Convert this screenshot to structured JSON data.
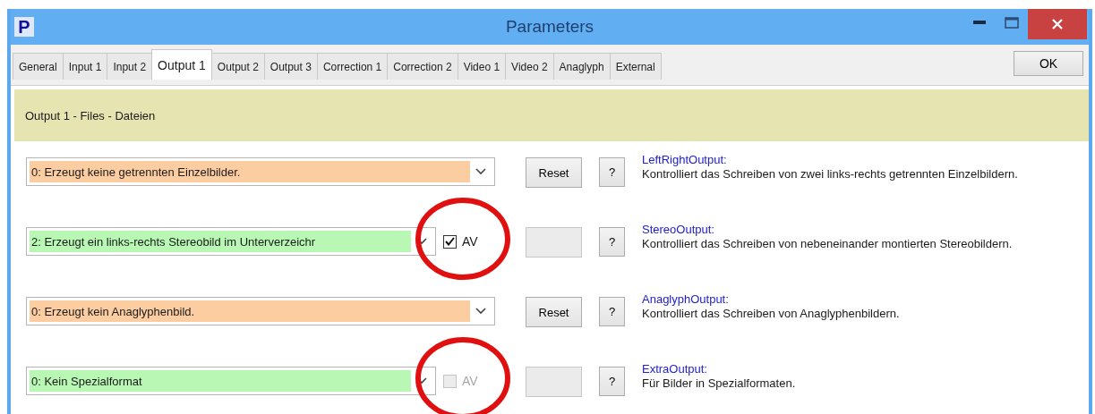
{
  "window": {
    "title": "Parameters",
    "icon_letter": "P"
  },
  "tabs": [
    {
      "label": "General",
      "selected": false
    },
    {
      "label": "Input 1",
      "selected": false
    },
    {
      "label": "Input 2",
      "selected": false
    },
    {
      "label": "Output 1",
      "selected": true
    },
    {
      "label": "Output 2",
      "selected": false
    },
    {
      "label": "Output 3",
      "selected": false
    },
    {
      "label": "Correction 1",
      "selected": false
    },
    {
      "label": "Correction 2",
      "selected": false
    },
    {
      "label": "Video 1",
      "selected": false
    },
    {
      "label": "Video 2",
      "selected": false
    },
    {
      "label": "Anaglyph",
      "selected": false
    },
    {
      "label": "External",
      "selected": false
    }
  ],
  "ok_button": "OK",
  "section_title": "Output 1 - Files - Dateien",
  "rows": [
    {
      "kind": "reset",
      "value": "0: Erzeugt keine getrennten Einzelbilder.",
      "color": "#fdcda2",
      "button": "Reset",
      "help": "?",
      "name": "LeftRightOutput:",
      "description": "Kontrolliert das Schreiben von zwei links-rechts getrennten Einzelbildern.",
      "circled": false
    },
    {
      "kind": "av",
      "value": "2: Erzeugt ein links-rechts Stereobild im Unterverzeichr",
      "color": "#b8f8b4",
      "checkbox": {
        "label": "AV",
        "checked": true,
        "disabled": false
      },
      "help": "?",
      "name": "StereoOutput:",
      "description": "Kontrolliert das Schreiben von nebeneinander montierten Stereobildern.",
      "circled": true
    },
    {
      "kind": "reset",
      "value": "0: Erzeugt kein Anaglyphenbild.",
      "color": "#fdcda2",
      "button": "Reset",
      "help": "?",
      "name": "AnaglyphOutput:",
      "description": "Kontrolliert das Schreiben von Anaglyphenbildern.",
      "circled": false
    },
    {
      "kind": "av",
      "value": "0: Kein Spezialformat",
      "color": "#b8f8b4",
      "checkbox": {
        "label": "AV",
        "checked": false,
        "disabled": true
      },
      "help": "?",
      "name": "ExtraOutput:",
      "description": "Für Bilder in Spezialformaten.",
      "circled": true
    }
  ]
}
